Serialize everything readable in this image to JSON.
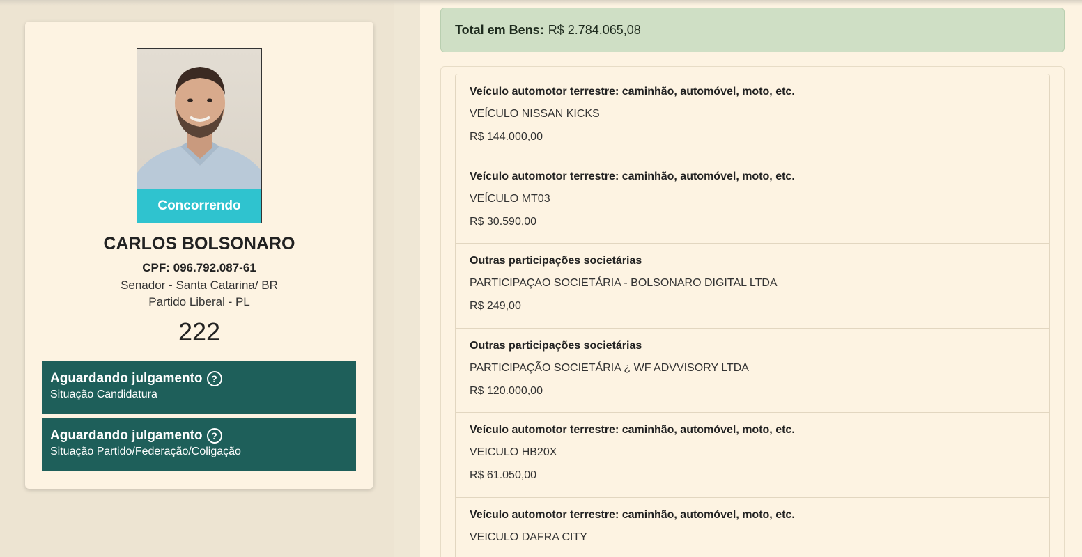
{
  "candidate": {
    "status_badge": "Concorrendo",
    "name": "CARLOS BOLSONARO",
    "cpf": "CPF: 096.792.087-61",
    "office": "Senador - Santa Catarina/ BR",
    "party": "Partido Liberal - PL",
    "number": "222",
    "statuses": [
      {
        "title": "Aguardando julgamento",
        "subtitle": "Situação Candidatura"
      },
      {
        "title": "Aguardando julgamento",
        "subtitle": "Situação Partido/Federação/Coligação"
      }
    ]
  },
  "assets": {
    "total_label": "Total em Bens:",
    "total_value": "R$ 2.784.065,08",
    "items": [
      {
        "type": "Veículo automotor terrestre: caminhão, automóvel, moto, etc.",
        "description": "VEÍCULO NISSAN KICKS",
        "value": "R$ 144.000,00"
      },
      {
        "type": "Veículo automotor terrestre: caminhão, automóvel, moto, etc.",
        "description": "VEÍCULO MT03",
        "value": "R$ 30.590,00"
      },
      {
        "type": "Outras participações societárias",
        "description": "PARTICIPAÇAO SOCIETÁRIA - BOLSONARO DIGITAL LTDA",
        "value": "R$ 249,00"
      },
      {
        "type": "Outras participações societárias",
        "description": "PARTICIPAÇÃO SOCIETÁRIA ¿ WF ADVVISORY LTDA",
        "value": "R$ 120.000,00"
      },
      {
        "type": "Veículo automotor terrestre: caminhão, automóvel, moto, etc.",
        "description": "VEICULO HB20X",
        "value": "R$ 61.050,00"
      },
      {
        "type": "Veículo automotor terrestre: caminhão, automóvel, moto, etc.",
        "description": "VEICULO DAFRA CITY",
        "value": ""
      }
    ]
  },
  "icons": {
    "help": "question-circle-icon"
  }
}
